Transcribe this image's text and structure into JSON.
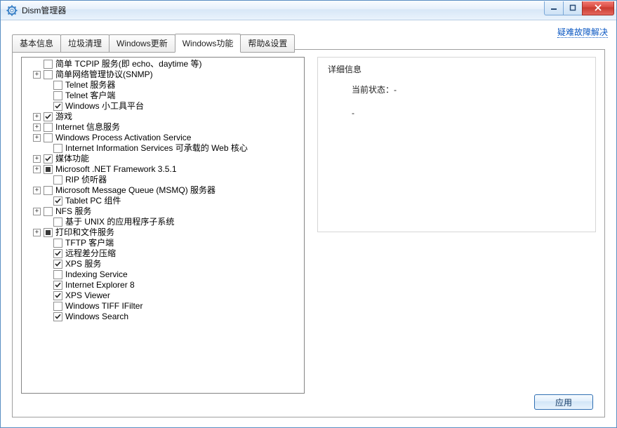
{
  "window": {
    "title": "Dism管理器"
  },
  "help_link": "疑难故障解决",
  "tabs": [
    {
      "label": "基本信息"
    },
    {
      "label": "垃圾清理"
    },
    {
      "label": "Windows更新"
    },
    {
      "label": "Windows功能",
      "active": true
    },
    {
      "label": "帮助&设置"
    }
  ],
  "detail": {
    "header": "详细信息",
    "state_label": "当前状态：",
    "state_value": "-",
    "extra_value": "-"
  },
  "apply_button": "应用",
  "tree": [
    {
      "depth": 1,
      "expand": "blank",
      "check": "unchecked",
      "label": "简单 TCPIP 服务(即 echo、daytime 等)"
    },
    {
      "depth": 1,
      "expand": "plus",
      "check": "unchecked",
      "label": "简单网络管理协议(SNMP)"
    },
    {
      "depth": 2,
      "expand": "blank",
      "check": "unchecked",
      "label": "Telnet 服务器"
    },
    {
      "depth": 2,
      "expand": "blank",
      "check": "unchecked",
      "label": "Telnet 客户端"
    },
    {
      "depth": 2,
      "expand": "blank",
      "check": "checked",
      "label": "Windows 小工具平台"
    },
    {
      "depth": 1,
      "expand": "plus",
      "check": "checked",
      "label": "游戏"
    },
    {
      "depth": 1,
      "expand": "plus",
      "check": "unchecked",
      "label": "Internet 信息服务"
    },
    {
      "depth": 1,
      "expand": "plus",
      "check": "unchecked",
      "label": "Windows Process Activation Service"
    },
    {
      "depth": 2,
      "expand": "blank",
      "check": "unchecked",
      "label": "Internet Information Services 可承载的 Web 核心"
    },
    {
      "depth": 1,
      "expand": "plus",
      "check": "checked",
      "label": "媒体功能"
    },
    {
      "depth": 1,
      "expand": "plus",
      "check": "mixed",
      "label": "Microsoft .NET Framework 3.5.1"
    },
    {
      "depth": 2,
      "expand": "blank",
      "check": "unchecked",
      "label": "RIP 侦听器"
    },
    {
      "depth": 1,
      "expand": "plus",
      "check": "unchecked",
      "label": "Microsoft Message Queue (MSMQ) 服务器"
    },
    {
      "depth": 2,
      "expand": "blank",
      "check": "checked",
      "label": "Tablet PC 组件"
    },
    {
      "depth": 1,
      "expand": "plus",
      "check": "unchecked",
      "label": "NFS 服务"
    },
    {
      "depth": 2,
      "expand": "blank",
      "check": "unchecked",
      "label": "基于 UNIX 的应用程序子系统"
    },
    {
      "depth": 1,
      "expand": "plus",
      "check": "mixed",
      "label": "打印和文件服务"
    },
    {
      "depth": 2,
      "expand": "blank",
      "check": "unchecked",
      "label": "TFTP 客户端"
    },
    {
      "depth": 2,
      "expand": "blank",
      "check": "checked",
      "label": "远程差分压缩"
    },
    {
      "depth": 2,
      "expand": "blank",
      "check": "checked",
      "label": "XPS 服务"
    },
    {
      "depth": 2,
      "expand": "blank",
      "check": "unchecked",
      "label": "Indexing Service"
    },
    {
      "depth": 2,
      "expand": "blank",
      "check": "checked",
      "label": "Internet Explorer 8"
    },
    {
      "depth": 2,
      "expand": "blank",
      "check": "checked",
      "label": "XPS Viewer"
    },
    {
      "depth": 2,
      "expand": "blank",
      "check": "unchecked",
      "label": "Windows TIFF IFilter"
    },
    {
      "depth": 2,
      "expand": "blank",
      "check": "checked",
      "label": "Windows Search"
    }
  ]
}
